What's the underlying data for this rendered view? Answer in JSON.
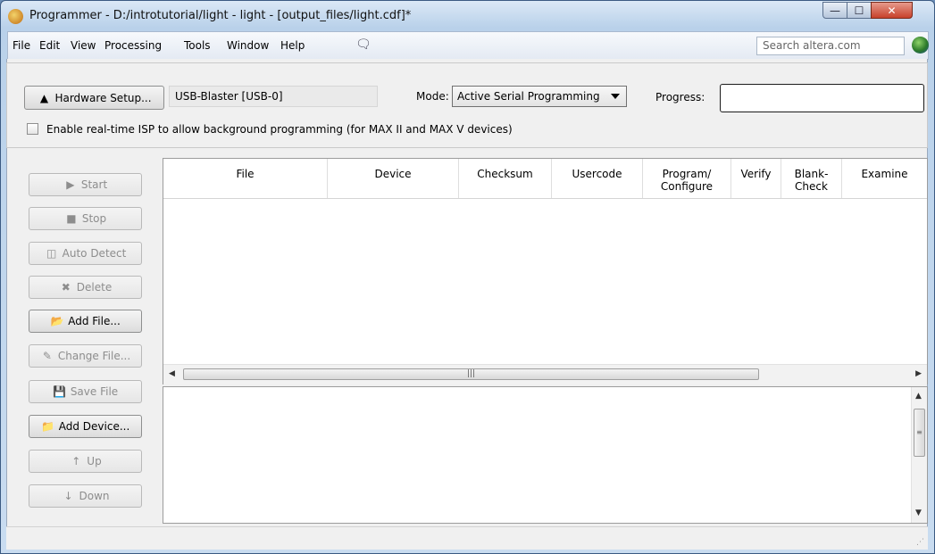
{
  "window": {
    "title": "Programmer - D:/introtutorial/light - light - [output_files/light.cdf]*",
    "controls": {
      "minimize": "—",
      "maximize": "☐",
      "close": "✕"
    }
  },
  "menu": {
    "items": [
      "File",
      "Edit",
      "View",
      "Processing",
      "Tools",
      "Window",
      "Help"
    ],
    "search_placeholder": "Search altera.com"
  },
  "toolbar": {
    "hardware_setup_label": "Hardware Setup...",
    "hardware_value": "USB-Blaster [USB-0]",
    "mode_label": "Mode:",
    "mode_value": "Active Serial Programming",
    "progress_label": "Progress:",
    "isp_checkbox_label": "Enable real-time ISP to allow background programming (for MAX II and MAX V devices)",
    "isp_checked": false
  },
  "side_buttons": [
    {
      "label": "Start",
      "enabled": false,
      "icon": "start-icon"
    },
    {
      "label": "Stop",
      "enabled": false,
      "icon": "stop-icon"
    },
    {
      "label": "Auto Detect",
      "enabled": false,
      "icon": "auto-detect-icon"
    },
    {
      "label": "Delete",
      "enabled": false,
      "icon": "delete-icon"
    },
    {
      "label": "Add File...",
      "enabled": true,
      "icon": "add-file-icon"
    },
    {
      "label": "Change File...",
      "enabled": false,
      "icon": "change-file-icon"
    },
    {
      "label": "Save File",
      "enabled": false,
      "icon": "save-file-icon"
    },
    {
      "label": "Add Device...",
      "enabled": true,
      "icon": "add-device-icon"
    },
    {
      "label": "Up",
      "enabled": false,
      "icon": "up-icon"
    },
    {
      "label": "Down",
      "enabled": false,
      "icon": "down-icon"
    }
  ],
  "table": {
    "columns": [
      {
        "line1": "File",
        "line2": ""
      },
      {
        "line1": "Device",
        "line2": ""
      },
      {
        "line1": "Checksum",
        "line2": ""
      },
      {
        "line1": "Usercode",
        "line2": ""
      },
      {
        "line1": "Program/",
        "line2": "Configure"
      },
      {
        "line1": "Verify",
        "line2": ""
      },
      {
        "line1": "Blank-",
        "line2": "Check"
      },
      {
        "line1": "Examine",
        "line2": ""
      }
    ],
    "rows": []
  },
  "colors": {
    "frame_blue": "#6d8fb8",
    "panel_gray": "#f0f0f0",
    "close_red": "#c7412b"
  }
}
